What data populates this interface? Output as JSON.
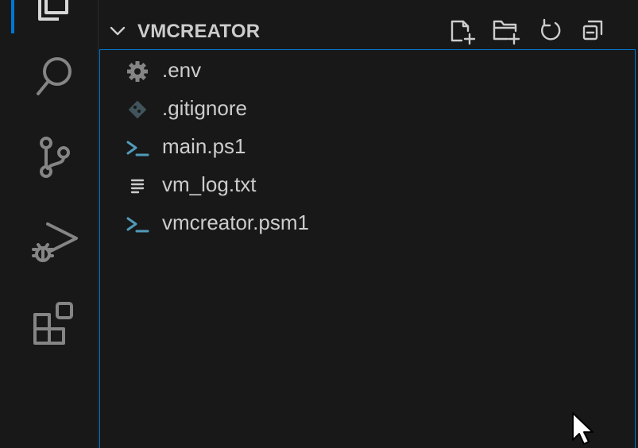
{
  "explorer": {
    "section_title": "VMCREATOR",
    "actions": [
      {
        "icon": "new-file-icon"
      },
      {
        "icon": "new-folder-icon"
      },
      {
        "icon": "refresh-icon"
      },
      {
        "icon": "collapse-all-icon"
      }
    ],
    "files": [
      {
        "label": ".env",
        "icon": "gear-icon"
      },
      {
        "label": ".gitignore",
        "icon": "git-icon"
      },
      {
        "label": "main.ps1",
        "icon": "powershell-icon"
      },
      {
        "label": "vm_log.txt",
        "icon": "text-file-icon"
      },
      {
        "label": "vmcreator.psm1",
        "icon": "powershell-icon"
      }
    ]
  },
  "activity_bar": {
    "items": [
      {
        "icon": "explorer-icon",
        "active": true
      },
      {
        "icon": "search-icon"
      },
      {
        "icon": "source-control-icon"
      },
      {
        "icon": "run-and-debug-icon"
      },
      {
        "icon": "extensions-icon"
      }
    ]
  },
  "colors": {
    "background": "#181818",
    "accent": "#0078d4",
    "text": "#cccccc",
    "icon_muted": "#858585",
    "powershell": "#519aba"
  }
}
